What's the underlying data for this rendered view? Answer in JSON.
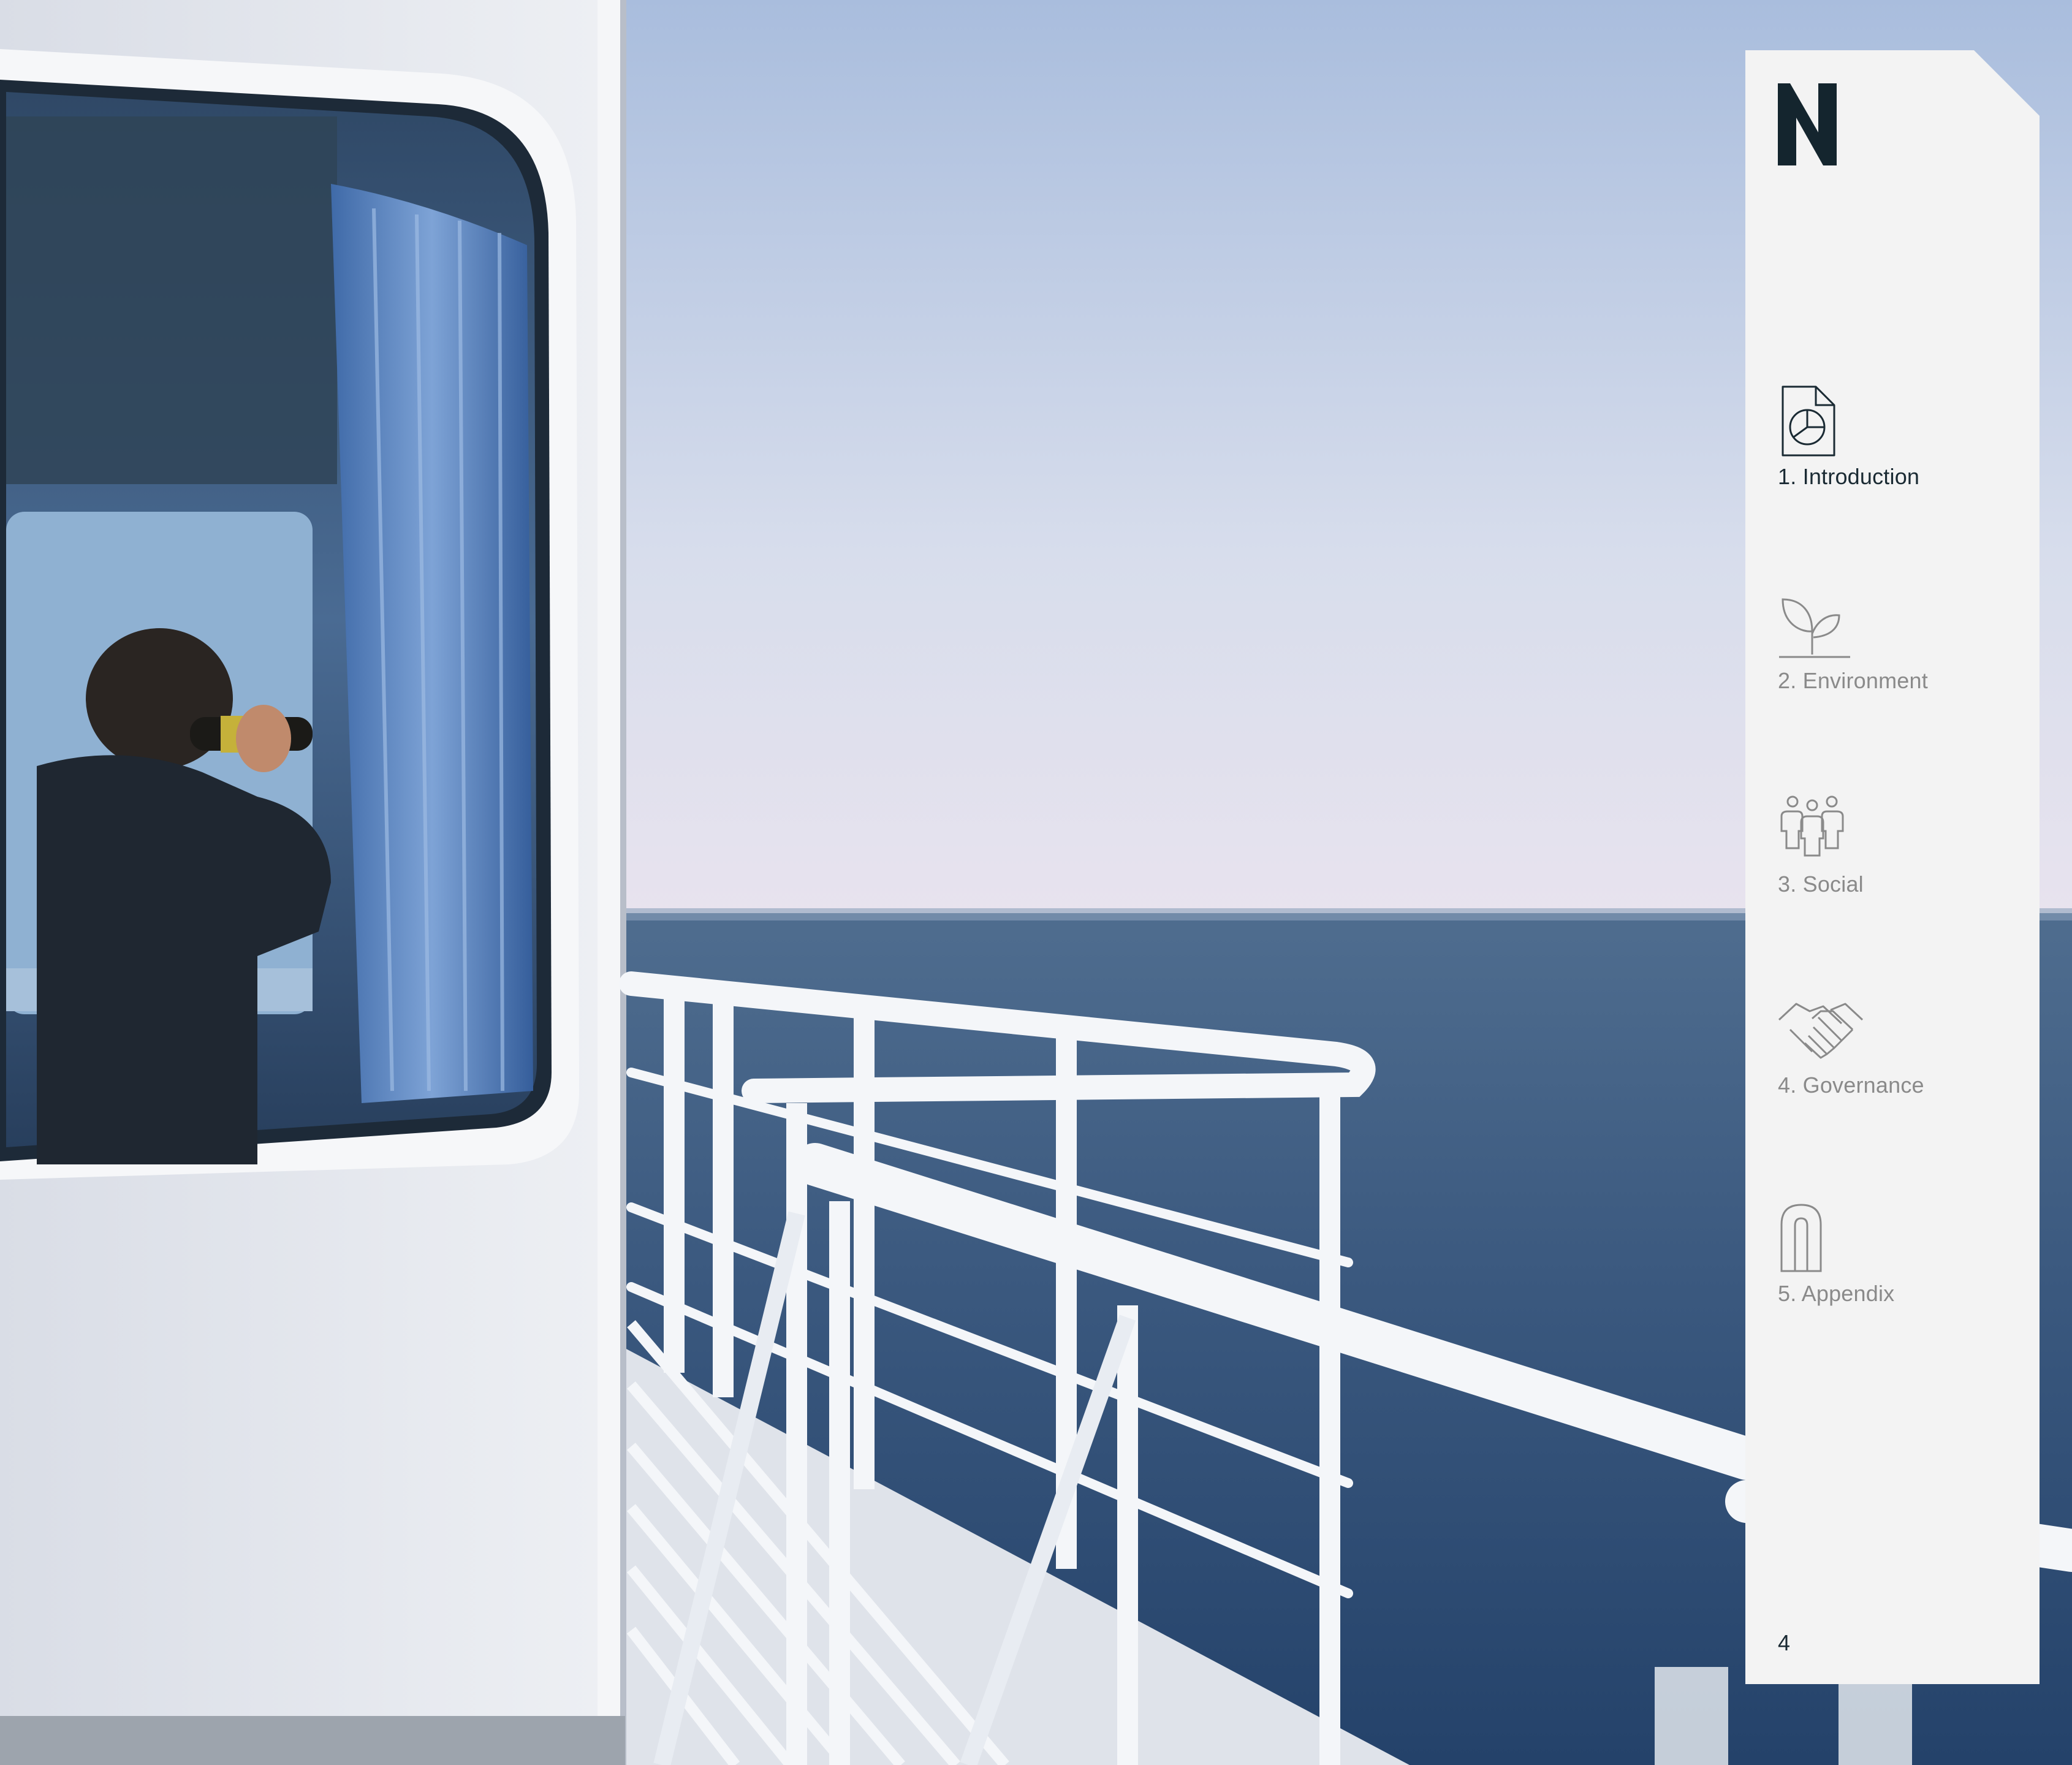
{
  "brand": {
    "logo_icon": "letter-n-logo-icon",
    "color": "#14252e"
  },
  "nav": {
    "items": [
      {
        "label": "1. Introduction",
        "icon": "document-chart-icon",
        "active": true
      },
      {
        "label": "2. Environment",
        "icon": "sprout-icon",
        "active": false
      },
      {
        "label": "3. Social",
        "icon": "people-group-icon",
        "active": false
      },
      {
        "label": "4. Governance",
        "icon": "handshake-icon",
        "active": false
      },
      {
        "label": "5. Appendix",
        "icon": "paperclip-icon",
        "active": false
      }
    ]
  },
  "page": {
    "number": "4"
  },
  "colors": {
    "panel": "#f3f3f3",
    "active_text": "#1a2a33",
    "inactive_text": "#8a8a8a"
  }
}
